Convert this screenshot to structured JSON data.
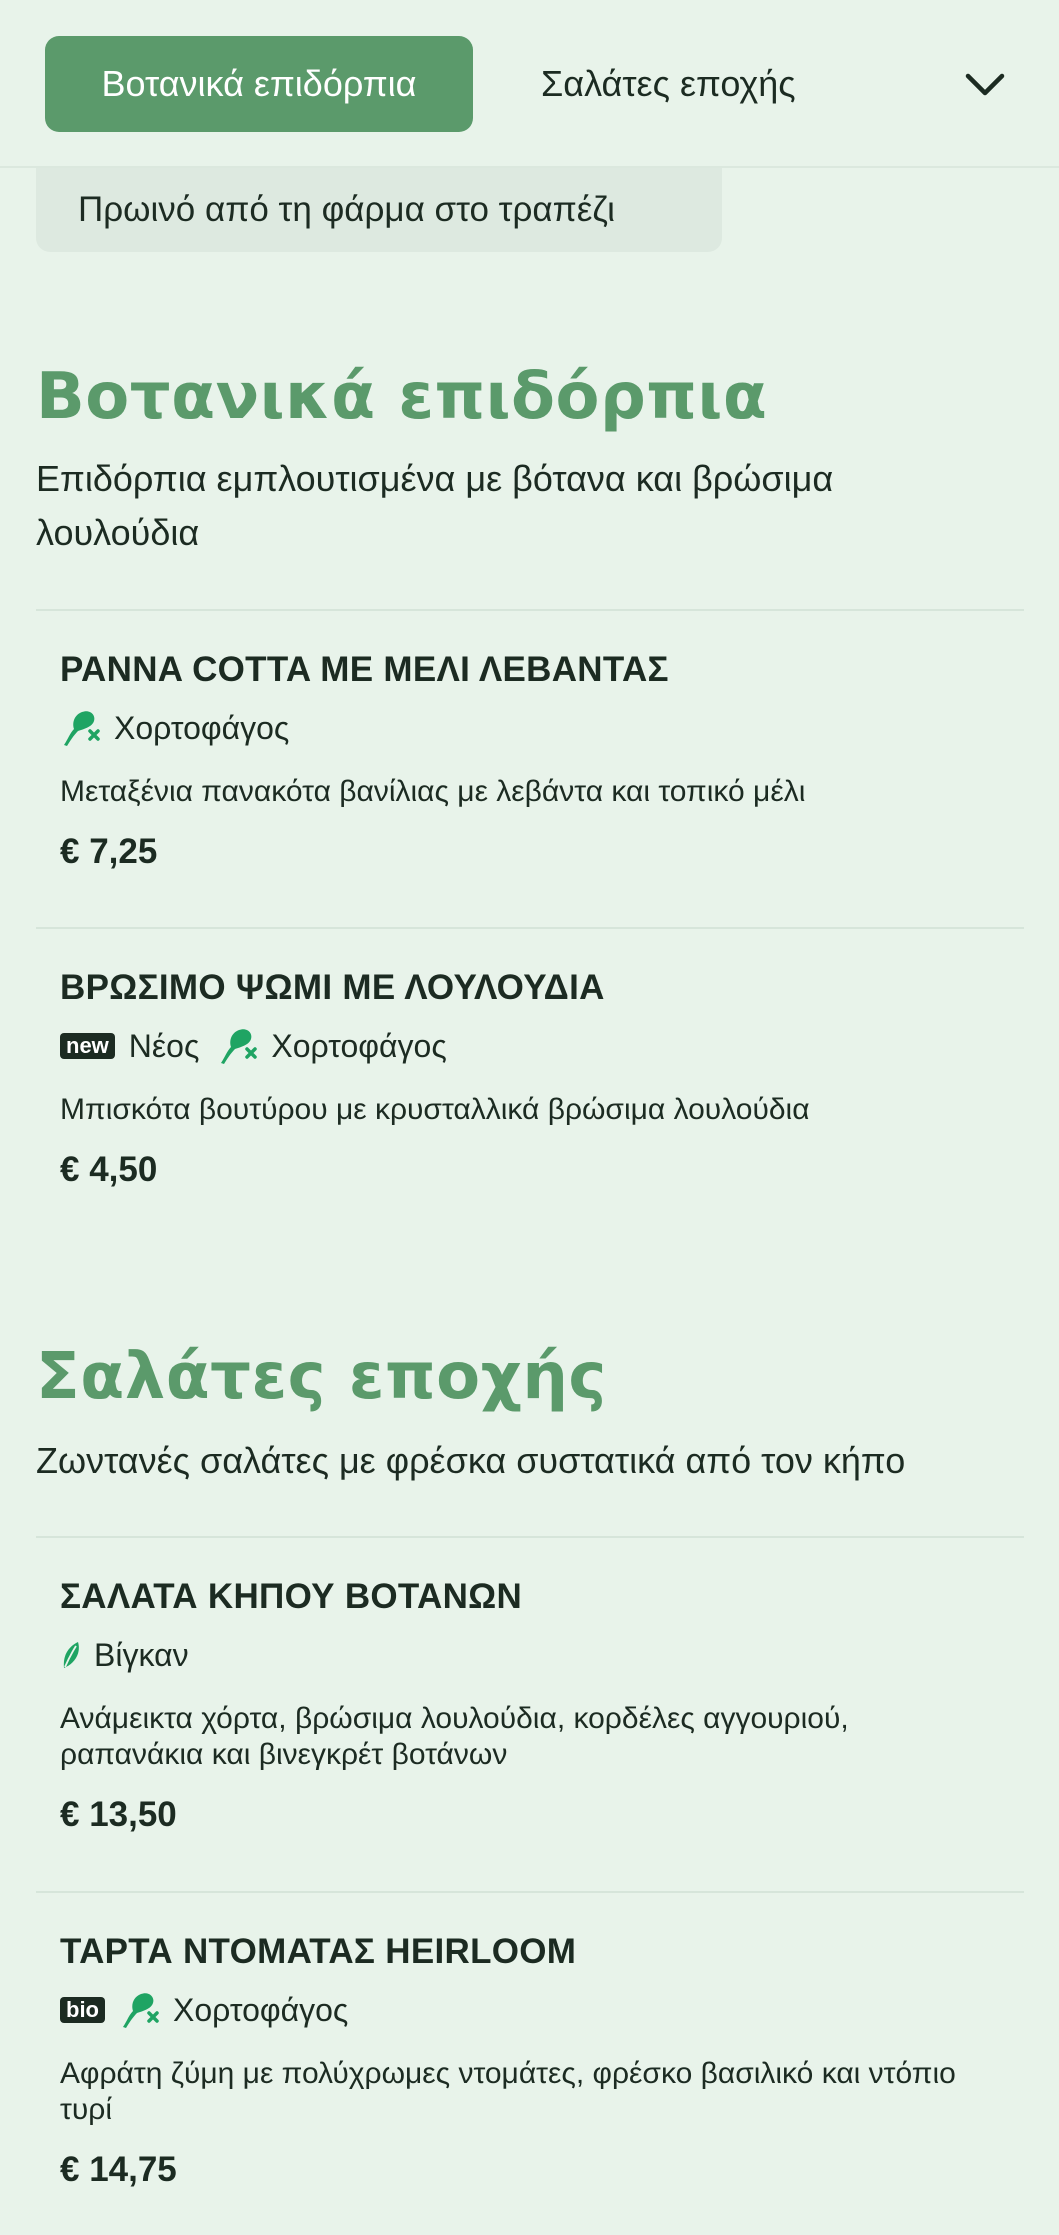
{
  "tabs": {
    "active_label": "Βοτανικά επιδόρπια",
    "next_label": "Σαλάτες εποχής",
    "more_icon": "chevron-down-icon",
    "partial_label": "Πρωινό από τη φάρμα στο τραπέζι"
  },
  "sections": [
    {
      "title": "Βοτανικά επιδόρπια",
      "description": "Επιδόρπια εμπλουτισμένα με βότανα και βρώσιμα λουλούδια",
      "items": [
        {
          "name": "PANNA COTTA ΜΕ ΜΕΛΙ ΛΕΒΑΝΤΑΣ",
          "tags": [
            {
              "icon": "vegetarian-icon",
              "label": "Χορτοφάγος"
            }
          ],
          "description": "Μεταξένια πανακότα βανίλιας με λεβάντα και τοπικό μέλι",
          "price": "€ 7,25"
        },
        {
          "name": "ΒΡΩΣΙΜΟ ΨΩΜΙ ΜΕ ΛΟΥΛΟΥΔΙΑ",
          "tags": [
            {
              "badge": "new",
              "label": "Νέος"
            },
            {
              "icon": "vegetarian-icon",
              "label": "Χορτοφάγος"
            }
          ],
          "description": "Μπισκότα βουτύρου με κρυσταλλικά βρώσιμα λουλούδια",
          "price": "€ 4,50"
        }
      ]
    },
    {
      "title": "Σαλάτες εποχής",
      "description": "Ζωντανές σαλάτες με φρέσκα συστατικά από τον κήπο",
      "items": [
        {
          "name": "ΣΑΛΑΤΑ ΚΗΠΟΥ ΒΟΤΑΝΩΝ",
          "tags": [
            {
              "icon": "vegan-leaf-icon",
              "label": "Βίγκαν"
            }
          ],
          "description": "Ανάμεικτα χόρτα, βρώσιμα λουλούδια, κορδέλες αγγουριού, ραπανάκια και βινεγκρέτ βοτάνων",
          "price": "€ 13,50"
        },
        {
          "name": "ΤΑΡΤΑ ΝΤΟΜΑΤΑΣ HEIRLOOM",
          "tags": [
            {
              "badge": "bio"
            },
            {
              "icon": "vegetarian-icon",
              "label": "Χορτοφάγος"
            }
          ],
          "description": "Αφράτη ζύμη με πολύχρωμες ντομάτες, φρέσκο βασιλικό και ντόπιο τυρί",
          "price": "€ 14,75"
        }
      ]
    }
  ],
  "colors": {
    "background": "#e8f3ea",
    "accent": "#5b9a6b",
    "icon_green": "#1fa463",
    "text": "#1c2b22"
  }
}
